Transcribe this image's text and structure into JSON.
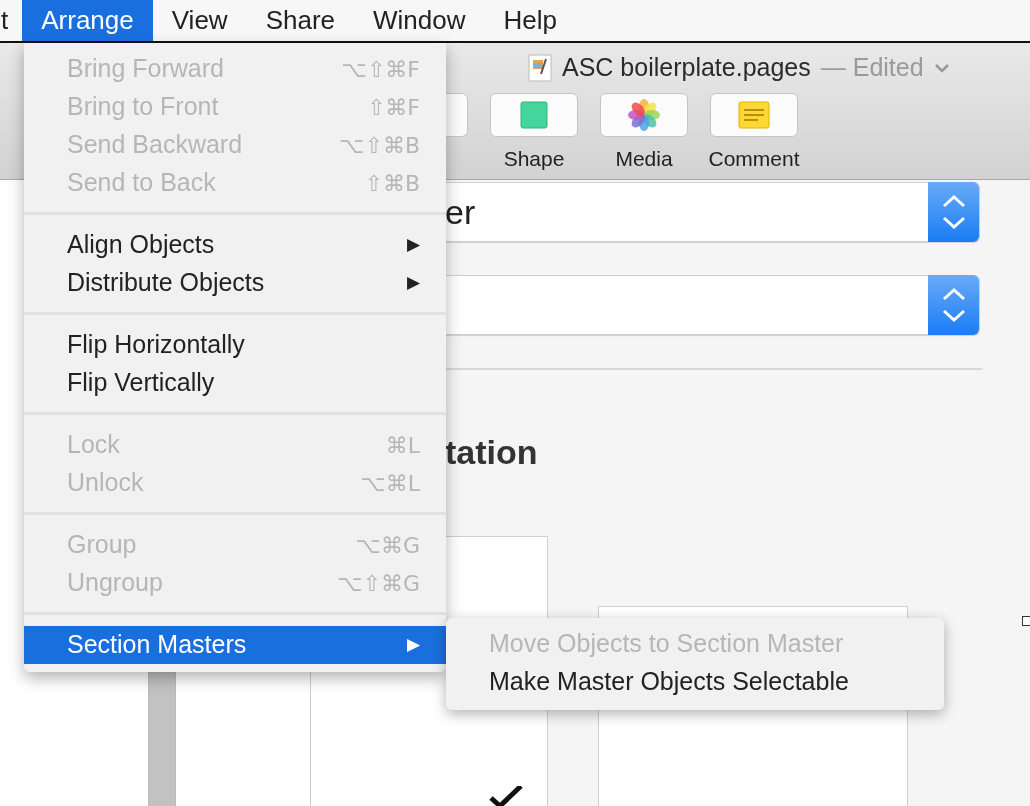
{
  "menubar": {
    "items": [
      {
        "label": "t",
        "selected": false
      },
      {
        "label": "Arrange",
        "selected": true
      },
      {
        "label": "View",
        "selected": false
      },
      {
        "label": "Share",
        "selected": false
      },
      {
        "label": "Window",
        "selected": false
      },
      {
        "label": "Help",
        "selected": false
      }
    ]
  },
  "window": {
    "title": "ASC boilerplate.pages",
    "status": "— Edited"
  },
  "toolbar": {
    "items": [
      {
        "kind": "shape",
        "label": "Shape"
      },
      {
        "kind": "media",
        "label": "Media"
      },
      {
        "kind": "comment",
        "label": "Comment"
      }
    ]
  },
  "inspector": {
    "popups": [
      {
        "kind": "text",
        "value": "er"
      },
      {
        "kind": "blank"
      }
    ],
    "heading": "tation"
  },
  "menu": {
    "groups": [
      {
        "items": [
          {
            "label": "Bring Forward",
            "shortcut": "⌥⇧⌘F",
            "disabled": true,
            "selected": false
          },
          {
            "label": "Bring to Front",
            "shortcut": "⇧⌘F",
            "disabled": true,
            "selected": false
          },
          {
            "label": "Send Backward",
            "shortcut": "⌥⇧⌘B",
            "disabled": true,
            "selected": false
          },
          {
            "label": "Send to Back",
            "shortcut": "⇧⌘B",
            "disabled": true,
            "selected": false
          }
        ]
      },
      {
        "items": [
          {
            "label": "Align Objects",
            "arrow": "▶",
            "disabled": false,
            "selected": false
          },
          {
            "label": "Distribute Objects",
            "arrow": "▶",
            "disabled": false,
            "selected": false
          }
        ]
      },
      {
        "items": [
          {
            "label": "Flip Horizontally",
            "disabled": false,
            "selected": false
          },
          {
            "label": "Flip Vertically",
            "disabled": false,
            "selected": false
          }
        ]
      },
      {
        "items": [
          {
            "label": "Lock",
            "shortcut": "⌘L",
            "disabled": true,
            "selected": false
          },
          {
            "label": "Unlock",
            "shortcut": "⌥⌘L",
            "disabled": true,
            "selected": false
          }
        ]
      },
      {
        "items": [
          {
            "label": "Group",
            "shortcut": "⌥⌘G",
            "disabled": true,
            "selected": false
          },
          {
            "label": "Ungroup",
            "shortcut": "⌥⇧⌘G",
            "disabled": true,
            "selected": false
          }
        ]
      },
      {
        "items": [
          {
            "label": "Section Masters",
            "arrow": "▶",
            "disabled": false,
            "selected": true
          }
        ]
      }
    ]
  },
  "submenu": {
    "items": [
      {
        "label": "Move Objects to Section Master",
        "disabled": true
      },
      {
        "label": "Make Master Objects Selectable",
        "disabled": false
      }
    ]
  }
}
